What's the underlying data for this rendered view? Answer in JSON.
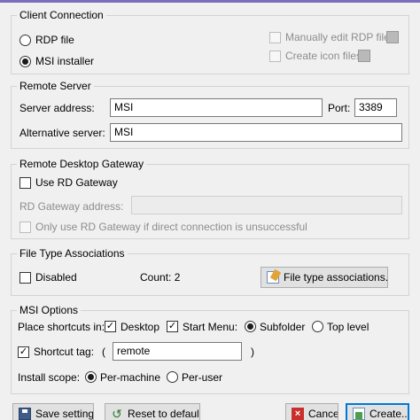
{
  "client_connection": {
    "legend": "Client Connection",
    "rdp_file": "RDP file",
    "msi_installer": "MSI installer",
    "selected": "msi_installer",
    "manually_edit": "Manually edit RDP file",
    "create_icon_files": "Create icon files"
  },
  "remote_server": {
    "legend": "Remote Server",
    "server_address_label": "Server address:",
    "server_address": "MSI",
    "port_label": "Port:",
    "port": "3389",
    "alternative_label": "Alternative server:",
    "alternative": "MSI"
  },
  "gateway": {
    "legend": "Remote Desktop Gateway",
    "use_rd_gateway": "Use RD Gateway",
    "address_label": "RD Gateway address:",
    "address": "",
    "only_use": "Only use RD Gateway if direct connection is unsuccessful"
  },
  "file_types": {
    "legend": "File Type Associations",
    "disabled": "Disabled",
    "count": "Count: 2",
    "button": "File type associations..."
  },
  "msi_options": {
    "legend": "MSI Options",
    "place_shortcuts": "Place shortcuts in:",
    "desktop": "Desktop",
    "start_menu": "Start Menu:",
    "subfolder": "Subfolder",
    "top_level": "Top level",
    "shortcut_tag": "Shortcut tag:",
    "paren_open": "(",
    "tag_value": "remote",
    "paren_close": ")",
    "install_scope": "Install scope:",
    "per_machine": "Per-machine",
    "per_user": "Per-user"
  },
  "buttons": {
    "save": "Save settings",
    "reset": "Reset to default",
    "cancel": "Cancel",
    "create": "Create..."
  },
  "colors": {
    "accent": "#0078d7",
    "title_bar": "#7a6fbf"
  }
}
